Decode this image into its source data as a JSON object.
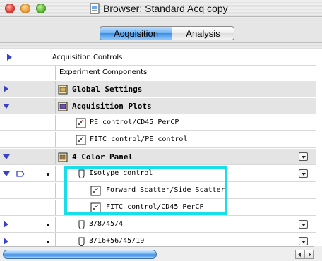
{
  "window": {
    "title": "Browser: Standard Acq copy"
  },
  "tabs": [
    {
      "label": "Acquisition",
      "active": true
    },
    {
      "label": "Analysis",
      "active": false
    }
  ],
  "sections": {
    "acquisition_controls": "Acquisition Controls",
    "experiment_components": "Experiment Components"
  },
  "rows": {
    "global_settings": "Global Settings",
    "acquisition_plots": "Acquisition Plots",
    "plot1": "PE control/CD45 PerCP",
    "plot2": "FITC control/PE control",
    "panel": "4 Color Panel",
    "isotype": "Isotype control",
    "iso_plot1": "Forward Scatter/Side Scatter",
    "iso_plot2": "FITC control/CD45 PerCP",
    "tube1": "3/8/45/4",
    "tube2": "3/16+56/45/19"
  },
  "colors": {
    "highlight": "#19dde8",
    "disclosure": "#3a43c8",
    "tab_active": "#6fb3f2"
  },
  "icons": {
    "folder": "folder-icon",
    "plot": "plot-icon",
    "tube": "tube-icon",
    "popup": "popup-menu-icon"
  }
}
